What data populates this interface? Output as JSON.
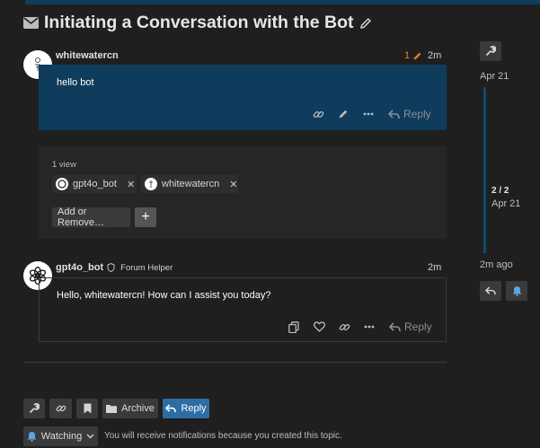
{
  "topic": {
    "title": "Initiating a Conversation with the Bot",
    "title_icon": "envelope-icon",
    "edit_icon": "pencil-icon"
  },
  "post1": {
    "username": "whitewatercn",
    "edit_count": "1",
    "time": "2m",
    "text": "hello bot",
    "reply_label": "Reply"
  },
  "participants": {
    "views": "1 view",
    "chips": [
      {
        "name": "gpt4o_bot"
      },
      {
        "name": "whitewatercn"
      }
    ],
    "add_remove_label": "Add or Remove…",
    "add_symbol": "+"
  },
  "post2": {
    "username": "gpt4o_bot",
    "badge": "Forum Helper",
    "time": "2m",
    "text": "Hello, whitewatercn! How can I assist you today?",
    "reply_label": "Reply"
  },
  "timeline": {
    "start_date": "Apr 21",
    "progress": "2 / 2",
    "progress_date": "Apr 21",
    "last_activity": "2m ago"
  },
  "footer": {
    "archive_label": "Archive",
    "reply_label": "Reply",
    "watching_label": "Watching",
    "notification_text": "You will receive notifications because you created this topic."
  },
  "colors": {
    "background": "#1f1f1f",
    "highlight_post": "#0f3b5c",
    "accent_blue": "#2e6da4",
    "timeline_bar": "#0f4c73",
    "edit_orange": "#e67e22"
  }
}
